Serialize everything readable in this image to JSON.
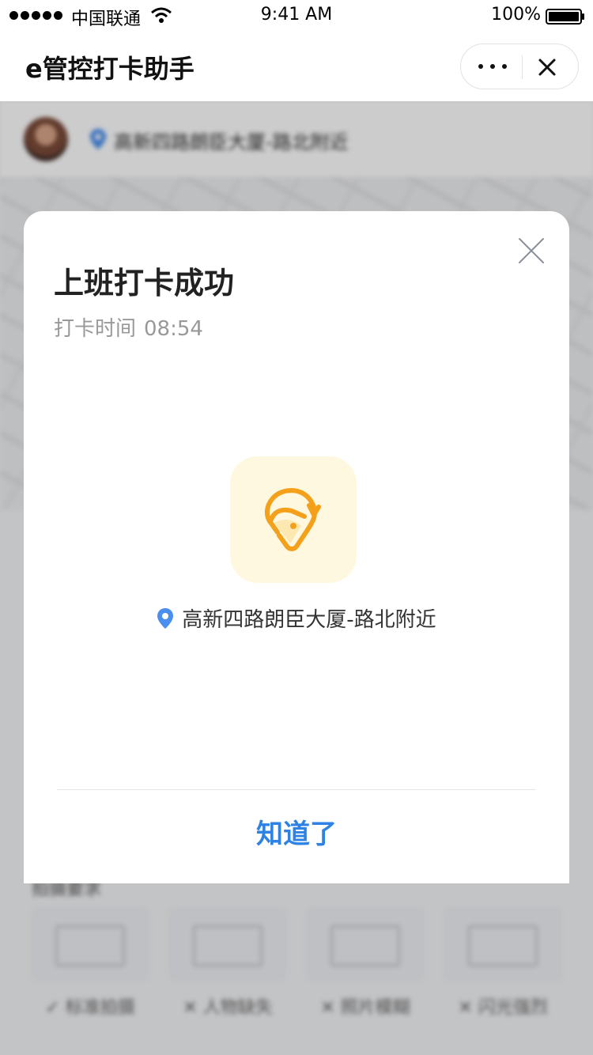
{
  "status_bar": {
    "carrier": "中国联通",
    "time": "9:41 AM",
    "battery": "100%"
  },
  "nav": {
    "title": "e管控打卡助手"
  },
  "background": {
    "location": "高新四路朗臣大厦-路北附近",
    "photo_section_title": "拍摄要求",
    "photo_requirements": [
      {
        "label": "✓ 标准拍摄"
      },
      {
        "label": "✕ 人物缺失"
      },
      {
        "label": "✕ 照片模糊"
      },
      {
        "label": "✕ 闪光强烈"
      }
    ]
  },
  "modal": {
    "title": "上班打卡成功",
    "time_label": "打卡时间",
    "time_value": "08:54",
    "location": "高新四路朗臣大厦-路北附近",
    "confirm_label": "知道了"
  },
  "colors": {
    "accent_blue": "#2e82e5",
    "success_orange": "#f5a01a",
    "success_bg": "#fff8e1",
    "pin_blue": "#4a8ff0"
  },
  "icons": {
    "modal_icon": "location-check-icon",
    "pin": "location-pin-icon",
    "close": "close-icon",
    "more": "more-icon"
  }
}
